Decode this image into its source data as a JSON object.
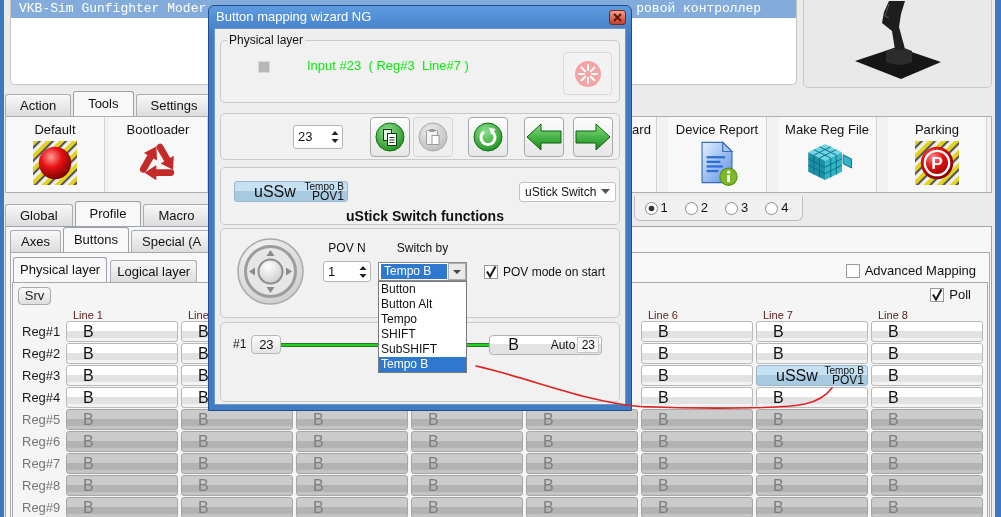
{
  "device_list": {
    "rows": [
      {
        "text_before_window": "VKB-Sim Gunfighter Moder",
        "text_after_window": "ровой контроллер",
        "selected": true
      }
    ]
  },
  "main_tabs": [
    {
      "label": "Action",
      "selected": false
    },
    {
      "label": "Tools",
      "selected": true
    },
    {
      "label": "Settings",
      "selected": false
    }
  ],
  "toolbar": {
    "left_items": [
      {
        "label": "Default",
        "kind": "alarm"
      },
      {
        "label": "Bootloader",
        "kind": "recycle"
      }
    ],
    "right_items": [
      {
        "label": "ard",
        "kind": "partial"
      },
      {
        "label": "Device Report",
        "kind": "report"
      },
      {
        "label": "Make Reg File",
        "kind": "cube"
      },
      {
        "label": "Parking",
        "kind": "parking",
        "icon_text": "P"
      }
    ]
  },
  "profile_tabs": [
    {
      "label": "Global",
      "selected": false
    },
    {
      "label": "Profile",
      "selected": true
    },
    {
      "label": "Macro",
      "selected": false
    }
  ],
  "profile_slots": [
    {
      "label": "1",
      "selected": true
    },
    {
      "label": "2",
      "selected": false
    },
    {
      "label": "3",
      "selected": false
    },
    {
      "label": "4",
      "selected": false
    }
  ],
  "control_tabs": [
    {
      "label": "Axes",
      "selected": false
    },
    {
      "label": "Buttons",
      "selected": true
    },
    {
      "label": "Special (A",
      "selected": false
    }
  ],
  "layer_tabs": [
    {
      "label": "Physical layer",
      "selected": true
    },
    {
      "label": "Logical layer",
      "selected": false
    }
  ],
  "advanced_mapping": {
    "label": "Advanced Mapping",
    "checked": false
  },
  "grid": {
    "srv_label": "Srv",
    "poll": {
      "label": "Poll",
      "checked": true
    },
    "columns": [
      "Line 1",
      "Line",
      null,
      null,
      null,
      "Line 6",
      "Line 7",
      "Line 8"
    ],
    "rows": [
      {
        "label": "Reg#1",
        "enabled": true,
        "cells": [
          {
            "kind": "button",
            "text": "B"
          },
          {
            "kind": "button",
            "text": "B"
          },
          null,
          null,
          null,
          {
            "kind": "button",
            "text": "B"
          },
          {
            "kind": "button",
            "text": "B"
          },
          {
            "kind": "button",
            "text": "B"
          }
        ]
      },
      {
        "label": "Reg#2",
        "enabled": true,
        "cells": [
          {
            "kind": "button",
            "text": "B"
          },
          {
            "kind": "button",
            "text": "B"
          },
          null,
          null,
          null,
          {
            "kind": "button",
            "text": "B"
          },
          {
            "kind": "button",
            "text": "B"
          },
          {
            "kind": "button",
            "text": "B"
          }
        ]
      },
      {
        "label": "Reg#3",
        "enabled": true,
        "cells": [
          {
            "kind": "button",
            "text": "B"
          },
          {
            "kind": "button",
            "text": "B"
          },
          null,
          null,
          null,
          {
            "kind": "button",
            "text": "B"
          },
          {
            "kind": "function",
            "text": "uSSw",
            "mode": "Tempo B",
            "pov": "POV1"
          },
          {
            "kind": "button",
            "text": "B"
          }
        ]
      },
      {
        "label": "Reg#4",
        "enabled": true,
        "cells": [
          {
            "kind": "button",
            "text": "B"
          },
          {
            "kind": "button",
            "text": "B"
          },
          null,
          null,
          null,
          {
            "kind": "button",
            "text": "B"
          },
          {
            "kind": "button",
            "text": "B"
          },
          {
            "kind": "button",
            "text": "B"
          }
        ]
      },
      {
        "label": "Reg#5",
        "enabled": false,
        "cells": [
          {
            "kind": "button",
            "text": "B"
          },
          {
            "kind": "button",
            "text": "B"
          },
          {
            "kind": "button",
            "text": "B"
          },
          {
            "kind": "button",
            "text": "B"
          },
          {
            "kind": "button",
            "text": "B"
          },
          {
            "kind": "button",
            "text": "B"
          },
          {
            "kind": "button",
            "text": "B"
          },
          {
            "kind": "button",
            "text": "B"
          }
        ]
      },
      {
        "label": "Reg#6",
        "enabled": false,
        "cells": [
          {
            "kind": "button",
            "text": "B"
          },
          {
            "kind": "button",
            "text": "B"
          },
          {
            "kind": "button",
            "text": "B"
          },
          {
            "kind": "button",
            "text": "B"
          },
          {
            "kind": "button",
            "text": "B"
          },
          {
            "kind": "button",
            "text": "B"
          },
          {
            "kind": "button",
            "text": "B"
          },
          {
            "kind": "button",
            "text": "B"
          }
        ]
      },
      {
        "label": "Reg#7",
        "enabled": false,
        "cells": [
          {
            "kind": "button",
            "text": "B"
          },
          {
            "kind": "button",
            "text": "B"
          },
          {
            "kind": "button",
            "text": "B"
          },
          {
            "kind": "button",
            "text": "B"
          },
          {
            "kind": "button",
            "text": "B"
          },
          {
            "kind": "button",
            "text": "B"
          },
          {
            "kind": "button",
            "text": "B"
          },
          {
            "kind": "button",
            "text": "B"
          }
        ]
      },
      {
        "label": "Reg#8",
        "enabled": false,
        "cells": [
          {
            "kind": "button",
            "text": "B"
          },
          {
            "kind": "button",
            "text": "B"
          },
          {
            "kind": "button",
            "text": "B"
          },
          {
            "kind": "button",
            "text": "B"
          },
          {
            "kind": "button",
            "text": "B"
          },
          {
            "kind": "button",
            "text": "B"
          },
          {
            "kind": "button",
            "text": "B"
          },
          {
            "kind": "button",
            "text": "B"
          }
        ]
      },
      {
        "label": "Reg#9",
        "enabled": false,
        "cells": [
          {
            "kind": "button",
            "text": "B"
          },
          {
            "kind": "button",
            "text": "B"
          },
          {
            "kind": "button",
            "text": "B"
          },
          {
            "kind": "button",
            "text": "B"
          },
          {
            "kind": "button",
            "text": "B"
          },
          {
            "kind": "button",
            "text": "B"
          },
          {
            "kind": "button",
            "text": "B"
          },
          {
            "kind": "button",
            "text": "B"
          }
        ]
      }
    ]
  },
  "wizard": {
    "title": "Button mapping wizard NG",
    "physical_layer": {
      "legend": "Physical layer",
      "active": false,
      "status": "Input #23  ( Reg#3  Line#7 )"
    },
    "navigation": {
      "input_number": "23",
      "actions": [
        {
          "kind": "copy",
          "enabled": true
        },
        {
          "kind": "paste",
          "enabled": false
        },
        {
          "kind": "reset",
          "enabled": true
        },
        {
          "kind": "back",
          "enabled": true
        },
        {
          "kind": "forward",
          "enabled": true
        }
      ]
    },
    "function": {
      "chip": {
        "text": "uSSw",
        "mode": "Tempo B",
        "pov": "POV1"
      },
      "type": "uStick Switch",
      "heading": "uStick Switch functions"
    },
    "pov_settings": {
      "pov_n_label": "POV N",
      "pov_n": "1",
      "switch_by_label": "Switch by",
      "switch_by": "Tempo B",
      "options": [
        {
          "label": "Button",
          "selected": false
        },
        {
          "label": "Button Alt",
          "selected": false
        },
        {
          "label": "Tempo",
          "selected": false
        },
        {
          "label": "SHIFT",
          "selected": false
        },
        {
          "label": "SubSHIFT",
          "selected": false
        },
        {
          "label": "Tempo B",
          "selected": true
        }
      ],
      "pov_mode": {
        "label": "POV mode on start",
        "checked": true
      }
    },
    "mapping": {
      "source_label": "#1",
      "source_value": "23",
      "target": {
        "text": "B",
        "mode": "Auto",
        "value": "23"
      }
    }
  }
}
